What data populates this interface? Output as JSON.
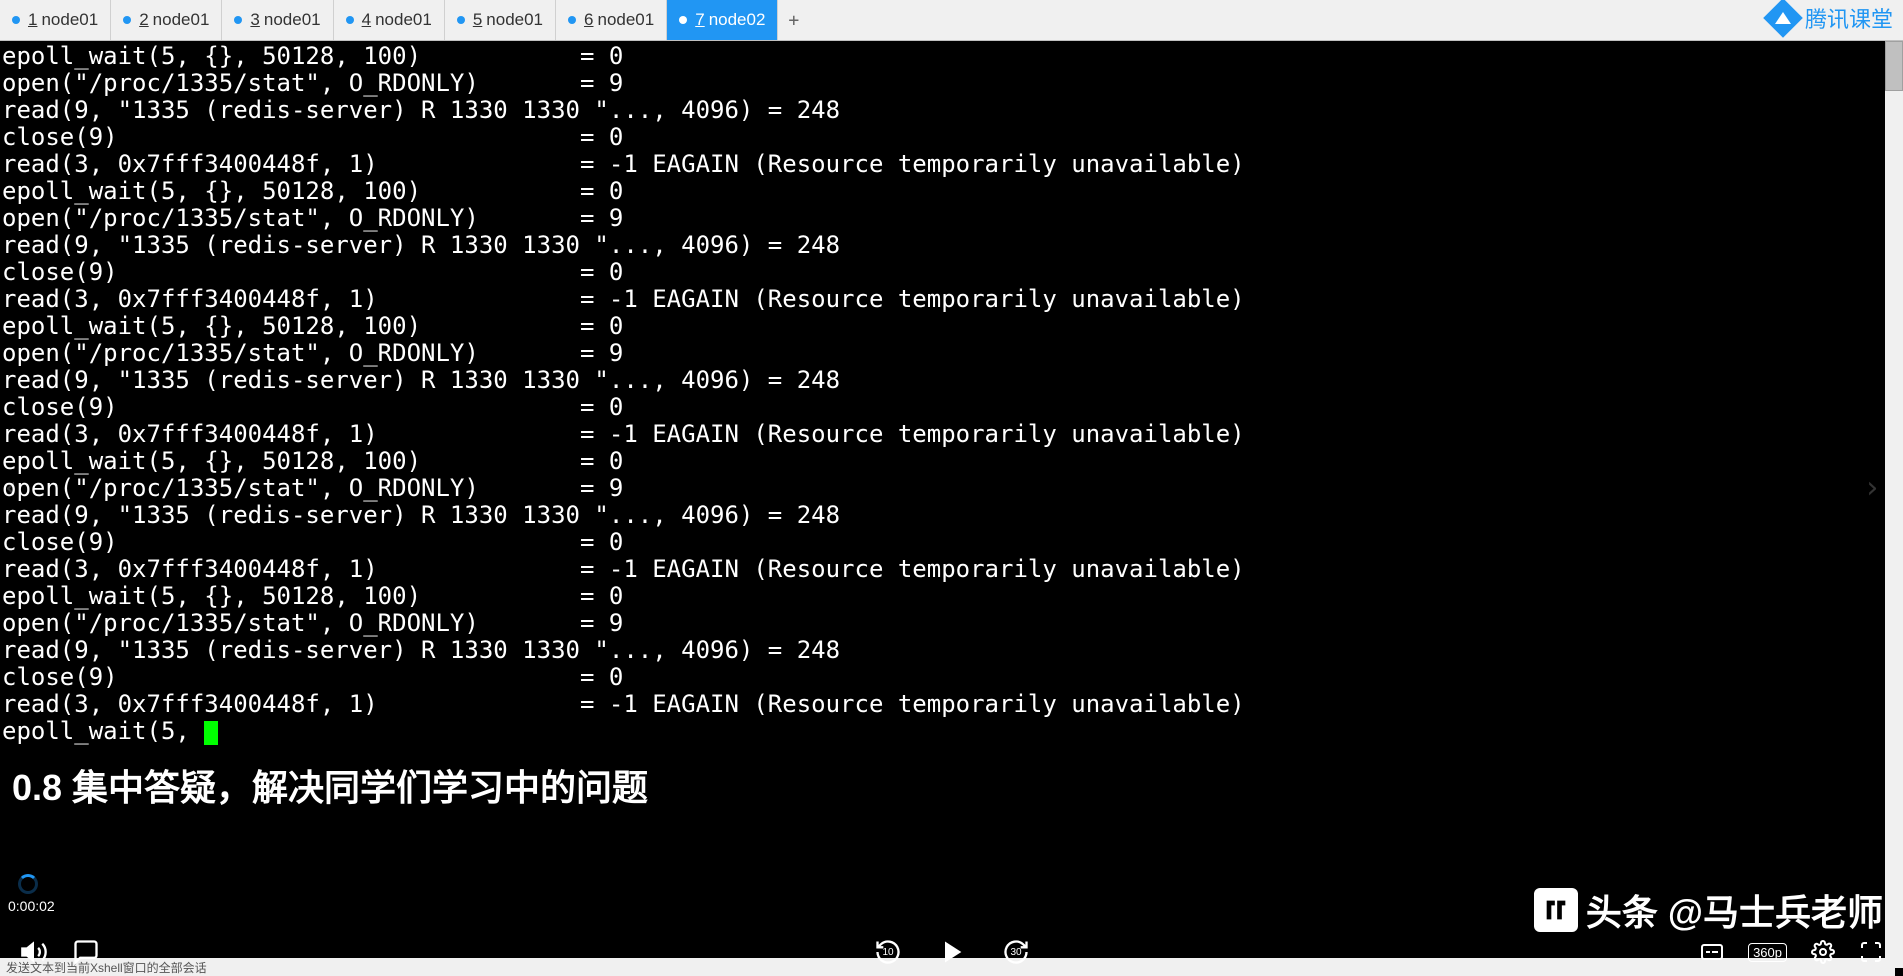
{
  "tabs": [
    {
      "num": "1",
      "label": "node01"
    },
    {
      "num": "2",
      "label": "node01"
    },
    {
      "num": "3",
      "label": "node01"
    },
    {
      "num": "4",
      "label": "node01"
    },
    {
      "num": "5",
      "label": "node01"
    },
    {
      "num": "6",
      "label": "node01"
    },
    {
      "num": "7",
      "label": "node02"
    }
  ],
  "active_tab": 6,
  "add_tab": "+",
  "brand": "腾讯课堂",
  "terminal_lines": [
    "epoll_wait(5, {}, 50128, 100)           = 0",
    "open(\"/proc/1335/stat\", O_RDONLY)       = 9",
    "read(9, \"1335 (redis-server) R 1330 1330 \"..., 4096) = 248",
    "close(9)                                = 0",
    "read(3, 0x7fff3400448f, 1)              = -1 EAGAIN (Resource temporarily unavailable)",
    "epoll_wait(5, {}, 50128, 100)           = 0",
    "open(\"/proc/1335/stat\", O_RDONLY)       = 9",
    "read(9, \"1335 (redis-server) R 1330 1330 \"..., 4096) = 248",
    "close(9)                                = 0",
    "read(3, 0x7fff3400448f, 1)              = -1 EAGAIN (Resource temporarily unavailable)",
    "epoll_wait(5, {}, 50128, 100)           = 0",
    "open(\"/proc/1335/stat\", O_RDONLY)       = 9",
    "read(9, \"1335 (redis-server) R 1330 1330 \"..., 4096) = 248",
    "close(9)                                = 0",
    "read(3, 0x7fff3400448f, 1)              = -1 EAGAIN (Resource temporarily unavailable)",
    "epoll_wait(5, {}, 50128, 100)           = 0",
    "open(\"/proc/1335/stat\", O_RDONLY)       = 9",
    "read(9, \"1335 (redis-server) R 1330 1330 \"..., 4096) = 248",
    "close(9)                                = 0",
    "read(3, 0x7fff3400448f, 1)              = -1 EAGAIN (Resource temporarily unavailable)",
    "epoll_wait(5, {}, 50128, 100)           = 0",
    "open(\"/proc/1335/stat\", O_RDONLY)       = 9",
    "read(9, \"1335 (redis-server) R 1330 1330 \"..., 4096) = 248",
    "close(9)                                = 0",
    "read(3, 0x7fff3400448f, 1)              = -1 EAGAIN (Resource temporarily unavailable)",
    "epoll_wait(5, "
  ],
  "subtitle": "0.8 集中答疑，解决同学们学习中的问题",
  "timestamp": "0:00:02",
  "status_bar": "发送文本到当前Xshell窗口的全部会话",
  "rewind_sec": "10",
  "forward_sec": "30",
  "quality": "360p",
  "watermark": "头条 @马士兵老师"
}
